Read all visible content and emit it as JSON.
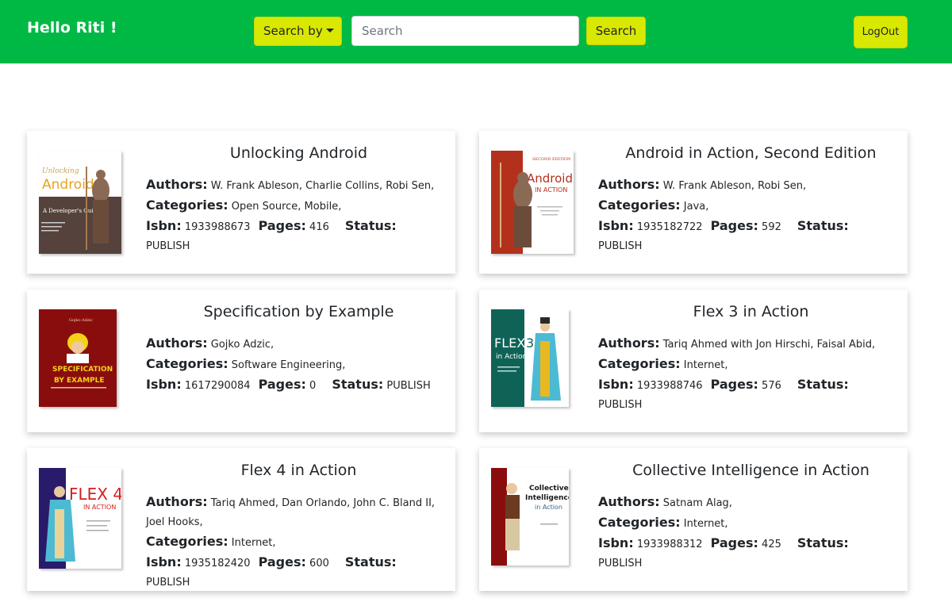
{
  "header": {
    "greeting": "Hello Riti !",
    "search_by_label": "Search by",
    "search_placeholder": "Search",
    "search_button": "Search",
    "logout_button": "LogOut"
  },
  "labels": {
    "authors": "Authors:",
    "categories": "Categories:",
    "isbn": "Isbn:",
    "pages": "Pages:",
    "status": "Status:"
  },
  "books": [
    {
      "title": "Unlocking Android",
      "authors": "W. Frank Ableson,  Charlie Collins,  Robi Sen,",
      "categories": "Open Source,  Mobile,",
      "isbn": "1933988673",
      "pages": "416",
      "status": "PUBLISH",
      "cover": {
        "bg": "#56423c",
        "top": "#ffffff",
        "accent": "#e8a31c",
        "title_text": "Android",
        "sub_text": "A Developer's Guide"
      }
    },
    {
      "title": "Android in Action, Second Edition",
      "authors": "W. Frank Ableson,  Robi Sen,",
      "categories": "Java,",
      "isbn": "1935182722",
      "pages": "592",
      "status": "PUBLISH",
      "cover": {
        "bg": "#b3311c",
        "top": "#ffffff",
        "accent": "#b3311c",
        "title_text": "Android",
        "sub_text": "IN ACTION"
      }
    },
    {
      "title": "Specification by Example",
      "authors": "Gojko Adzic,",
      "categories": "Software Engineering,",
      "isbn": "1617290084",
      "pages": "0",
      "status": "PUBLISH",
      "cover": {
        "bg": "#8a0d0d",
        "top": "#8a0d0d",
        "accent": "#f5d21a",
        "title_text": "SPECIFICATION BY EXAMPLE",
        "sub_text": ""
      }
    },
    {
      "title": "Flex 3 in Action",
      "authors": "Tariq Ahmed with Jon Hirschi,  Faisal Abid,",
      "categories": "Internet,",
      "isbn": "1933988746",
      "pages": "576",
      "status": "PUBLISH",
      "cover": {
        "bg": "#0e6356",
        "top": "#0e6356",
        "accent": "#ffffff",
        "title_text": "FLEX 3",
        "sub_text": "in Action"
      }
    },
    {
      "title": "Flex 4 in Action",
      "authors": "Tariq Ahmed,  Dan Orlando,  John C. Bland II,  Joel Hooks,",
      "categories": "Internet,",
      "isbn": "1935182420",
      "pages": "600",
      "status": "PUBLISH",
      "cover": {
        "bg": "#2a1a6b",
        "top": "#ffffff",
        "accent": "#d32020",
        "title_text": "FLEX 4",
        "sub_text": "IN ACTION"
      }
    },
    {
      "title": "Collective Intelligence in Action",
      "authors": "Satnam Alag,",
      "categories": "Internet,",
      "isbn": "1933988312",
      "pages": "425",
      "status": "PUBLISH",
      "cover": {
        "bg": "#8a0d0d",
        "top": "#ffffff",
        "accent": "#2d6b8c",
        "title_text": "Collective Intelligence",
        "sub_text": "in Action"
      }
    }
  ]
}
